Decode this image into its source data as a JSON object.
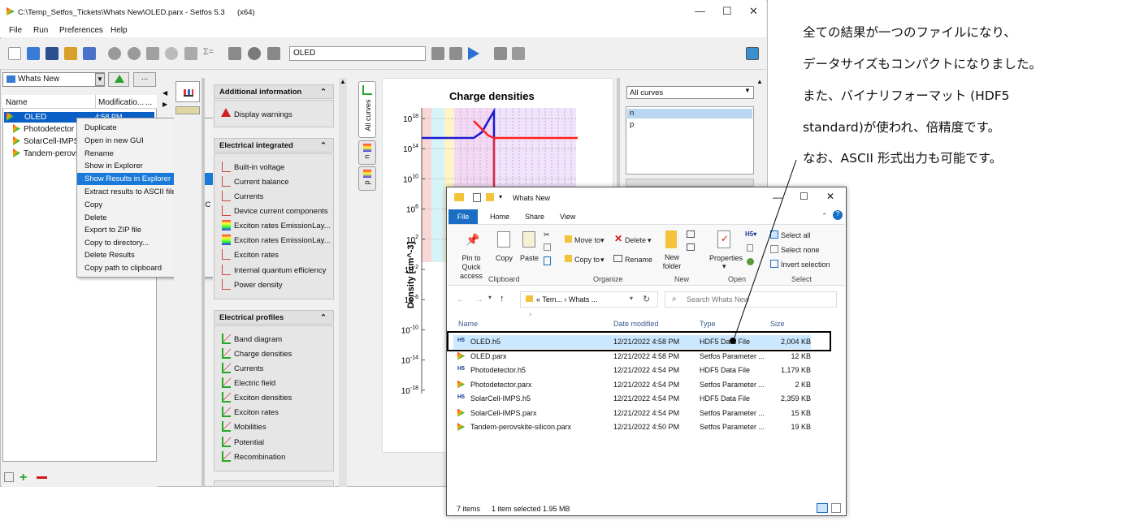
{
  "setfos": {
    "title": "C:\\Temp_Setfos_Tickets\\Whats New\\OLED.parx - Setfos 5.3",
    "arch": "(x64)",
    "menu": [
      "File",
      "Run",
      "Preferences",
      "Help"
    ],
    "search_value": "OLED",
    "project_select": "Whats New",
    "tree_cols": {
      "name": "Name",
      "modified": "Modificatio..."
    },
    "tree_items": [
      "OLED",
      "Photodetector",
      "SolarCell-IMPS",
      "Tandem-perovs"
    ],
    "tree_time": "4:58 PM",
    "context_menu": [
      "Duplicate",
      "Open in new GUI",
      "Rename",
      "Show in Explorer",
      "Show Results in Explorer",
      "Extract results to ASCII files",
      "Copy",
      "Delete",
      "Export to ZIP file",
      "Copy to directory...",
      "Delete Results",
      "Copy path to clipboard"
    ],
    "copy_shortcut": "Ctrl+C",
    "groups": {
      "additional": {
        "title": "Additional information",
        "items": [
          "Display warnings"
        ]
      },
      "integrated": {
        "title": "Electrical integrated",
        "items": [
          "Built-in voltage",
          "Current balance",
          "Currents",
          "Device current components",
          "Exciton rates EmissionLay...",
          "Exciton rates EmissionLay...",
          "Exciton rates",
          "Internal quantum efficiency",
          "Power density"
        ]
      },
      "profiles": {
        "title": "Electrical profiles",
        "items": [
          "Band diagram",
          "Charge densities",
          "Currents",
          "Electric field",
          "Exciton densities",
          "Exciton rates",
          "Mobilities",
          "Potential",
          "Recombination"
        ]
      }
    },
    "vtabs": [
      "All curves",
      "n",
      "p"
    ],
    "curves_select": "All curves",
    "curves": [
      "n",
      "p"
    ],
    "colors": {
      "accent": "#0a5fc7",
      "menu_highlight": "#1a7ad9"
    }
  },
  "chart_data": {
    "type": "line",
    "title": "Charge densities",
    "ylabel": "Density [cm^-3]",
    "xlabel": "",
    "yscale": "log",
    "yticks": [
      "10^18",
      "10^14",
      "10^10",
      "10^6",
      "10^2",
      "10^-2",
      "10^-6",
      "10^-10",
      "10^-14",
      "10^-18"
    ],
    "series": [
      {
        "name": "n",
        "color": "#ff2020"
      },
      {
        "name": "p",
        "color": "#1a1ad0"
      }
    ]
  },
  "explorer": {
    "title": "Whats New",
    "tabs": [
      "File",
      "Home",
      "Share",
      "View"
    ],
    "ribbon": {
      "pin": "Pin to Quick access",
      "copy": "Copy",
      "paste": "Paste",
      "move_to": "Move to",
      "delete": "Delete",
      "copy_to": "Copy to",
      "rename": "Rename",
      "new_folder": "New folder",
      "properties": "Properties",
      "select_all": "Select all",
      "select_none": "Select none",
      "invert": "Invert selection",
      "groups": [
        "Clipboard",
        "Organize",
        "New",
        "Open",
        "Select"
      ]
    },
    "address": "« Tem... › Whats ...",
    "search_placeholder": "Search Whats New",
    "columns": [
      "Name",
      "Date modified",
      "Type",
      "Size"
    ],
    "files": [
      {
        "name": "OLED.h5",
        "date": "12/21/2022 4:58 PM",
        "type": "HDF5 Data File",
        "size": "2,004 KB"
      },
      {
        "name": "OLED.parx",
        "date": "12/21/2022 4:58 PM",
        "type": "Setfos Parameter ...",
        "size": "12 KB"
      },
      {
        "name": "Photodetector.h5",
        "date": "12/21/2022 4:54 PM",
        "type": "HDF5 Data File",
        "size": "1,179 KB"
      },
      {
        "name": "Photodetector.parx",
        "date": "12/21/2022 4:54 PM",
        "type": "Setfos Parameter ...",
        "size": "2 KB"
      },
      {
        "name": "SolarCell-IMPS.h5",
        "date": "12/21/2022 4:54 PM",
        "type": "HDF5 Data File",
        "size": "2,359 KB"
      },
      {
        "name": "SolarCell-IMPS.parx",
        "date": "12/21/2022 4:54 PM",
        "type": "Setfos Parameter ...",
        "size": "15 KB"
      },
      {
        "name": "Tandem-perovskite-silicon.parx",
        "date": "12/21/2022 4:50 PM",
        "type": "Setfos Parameter ...",
        "size": "19 KB"
      }
    ],
    "status_items": "7 items",
    "status_selected": "1 item selected  1.95 MB"
  },
  "annotation": [
    "全ての結果が一つのファイルになり、",
    "データサイズもコンパクトになりました。",
    "また、バイナリフォーマット (HDF5",
    "standard)が使われ、倍精度です。",
    "なお、ASCII 形式出力も可能です。"
  ]
}
